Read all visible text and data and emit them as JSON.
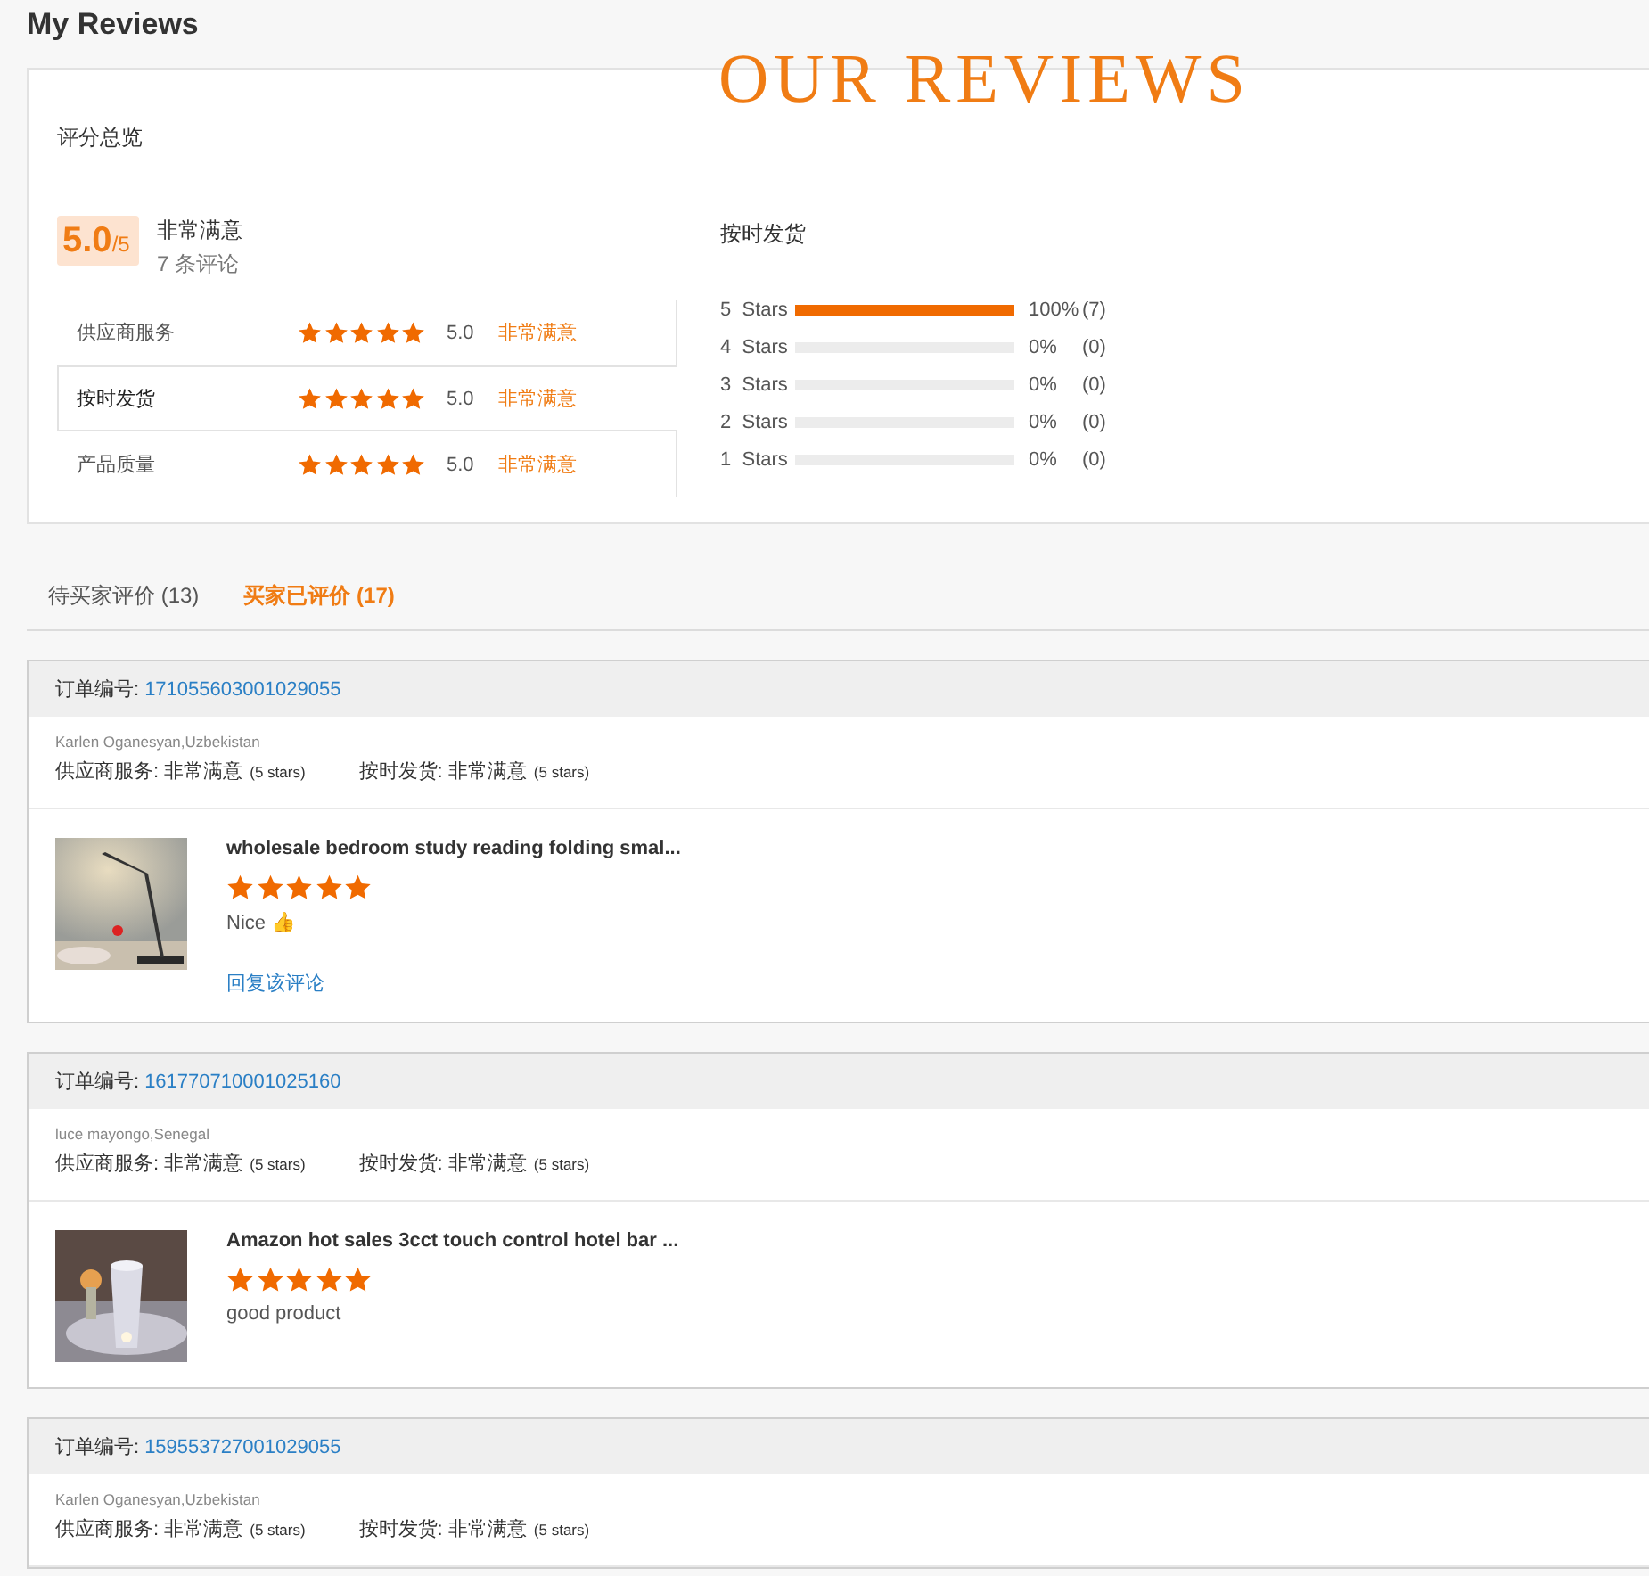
{
  "page_title": "My Reviews",
  "overlay_title": "OUR REVIEWS",
  "summary": {
    "heading": "评分总览",
    "score": "5.0",
    "score_max": "/5",
    "verdict": "非常满意",
    "review_count": "7 条评论",
    "rows": [
      {
        "label": "供应商服务",
        "stars": 5,
        "value": "5.0",
        "verdict": "非常满意",
        "selected": false
      },
      {
        "label": "按时发货",
        "stars": 5,
        "value": "5.0",
        "verdict": "非常满意",
        "selected": true
      },
      {
        "label": "产品质量",
        "stars": 5,
        "value": "5.0",
        "verdict": "非常满意",
        "selected": false
      }
    ],
    "distribution": {
      "title": "按时发货",
      "rows": [
        {
          "label": "5  Stars",
          "level": 1,
          "percent": "100%",
          "count": "(7)"
        },
        {
          "label": "4  Stars",
          "level": 0,
          "percent": "0%",
          "count": "(0)"
        },
        {
          "label": "3  Stars",
          "level": 0,
          "percent": "0%",
          "count": "(0)"
        },
        {
          "label": "2  Stars",
          "level": 0,
          "percent": "0%",
          "count": "(0)"
        },
        {
          "label": "1  Stars",
          "level": 0,
          "percent": "0%",
          "count": "(0)"
        }
      ]
    }
  },
  "tabs": [
    {
      "label": "待买家评价 (13)",
      "selected": false
    },
    {
      "label": "买家已评价 (17)",
      "selected": true
    }
  ],
  "reviews": [
    {
      "order_label": "订单编号:",
      "order_number": "171055603001029055",
      "buyer": "Karlen Oganesyan,Uzbekistan",
      "ratings": [
        {
          "label": "供应商服务:",
          "verdict": "非常满意",
          "stars_text": "(5 stars)"
        },
        {
          "label": "按时发货:",
          "verdict": "非常满意",
          "stars_text": "(5 stars)"
        }
      ],
      "product": {
        "title": "wholesale bedroom study reading folding smal...",
        "stars": 5,
        "comment": "Nice 👍",
        "reply_link": "回复该评论"
      }
    },
    {
      "order_label": "订单编号:",
      "order_number": "161770710001025160",
      "buyer": "luce mayongo,Senegal",
      "ratings": [
        {
          "label": "供应商服务:",
          "verdict": "非常满意",
          "stars_text": "(5 stars)"
        },
        {
          "label": "按时发货:",
          "verdict": "非常满意",
          "stars_text": "(5 stars)"
        }
      ],
      "product": {
        "title": "Amazon hot sales 3cct touch control hotel bar ...",
        "stars": 5,
        "comment": "good product"
      }
    },
    {
      "order_label": "订单编号:",
      "order_number": "159553727001029055",
      "buyer": "Karlen Oganesyan,Uzbekistan",
      "ratings": [
        {
          "label": "供应商服务:",
          "verdict": "非常满意",
          "stars_text": "(5 stars)"
        },
        {
          "label": "按时发货:",
          "verdict": "非常满意",
          "stars_text": "(5 stars)"
        }
      ]
    }
  ]
}
